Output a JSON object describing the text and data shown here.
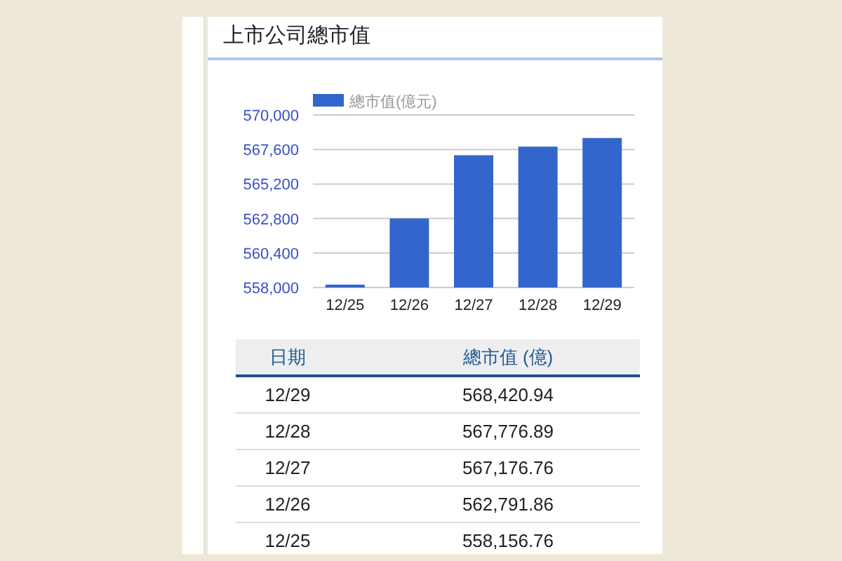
{
  "card": {
    "title": "上市公司總市值"
  },
  "chart": {
    "chart_data": {
      "type": "bar",
      "categories": [
        "12/25",
        "12/26",
        "12/27",
        "12/28",
        "12/29"
      ],
      "series": [
        {
          "name": "總市值(億元)",
          "color": "#3366cc",
          "values": [
            558200,
            562800,
            567200,
            567800,
            568400
          ]
        }
      ],
      "grid": true,
      "ylim": [
        558000,
        570000
      ],
      "yticks": [
        {
          "value": 558000,
          "label": "558,000"
        },
        {
          "value": 560400,
          "label": "560,400"
        },
        {
          "value": 562800,
          "label": "562,800"
        },
        {
          "value": 565200,
          "label": "565,200"
        },
        {
          "value": 567600,
          "label": "567,600"
        },
        {
          "value": 570000,
          "label": "570,000"
        }
      ]
    }
  },
  "table": {
    "columns": [
      "日期",
      "總市值 (億)"
    ],
    "rows": [
      [
        "12/29",
        "568,420.94"
      ],
      [
        "12/28",
        "567,776.89"
      ],
      [
        "12/27",
        "567,176.76"
      ],
      [
        "12/26",
        "562,791.86"
      ],
      [
        "12/25",
        "558,156.76"
      ]
    ]
  }
}
